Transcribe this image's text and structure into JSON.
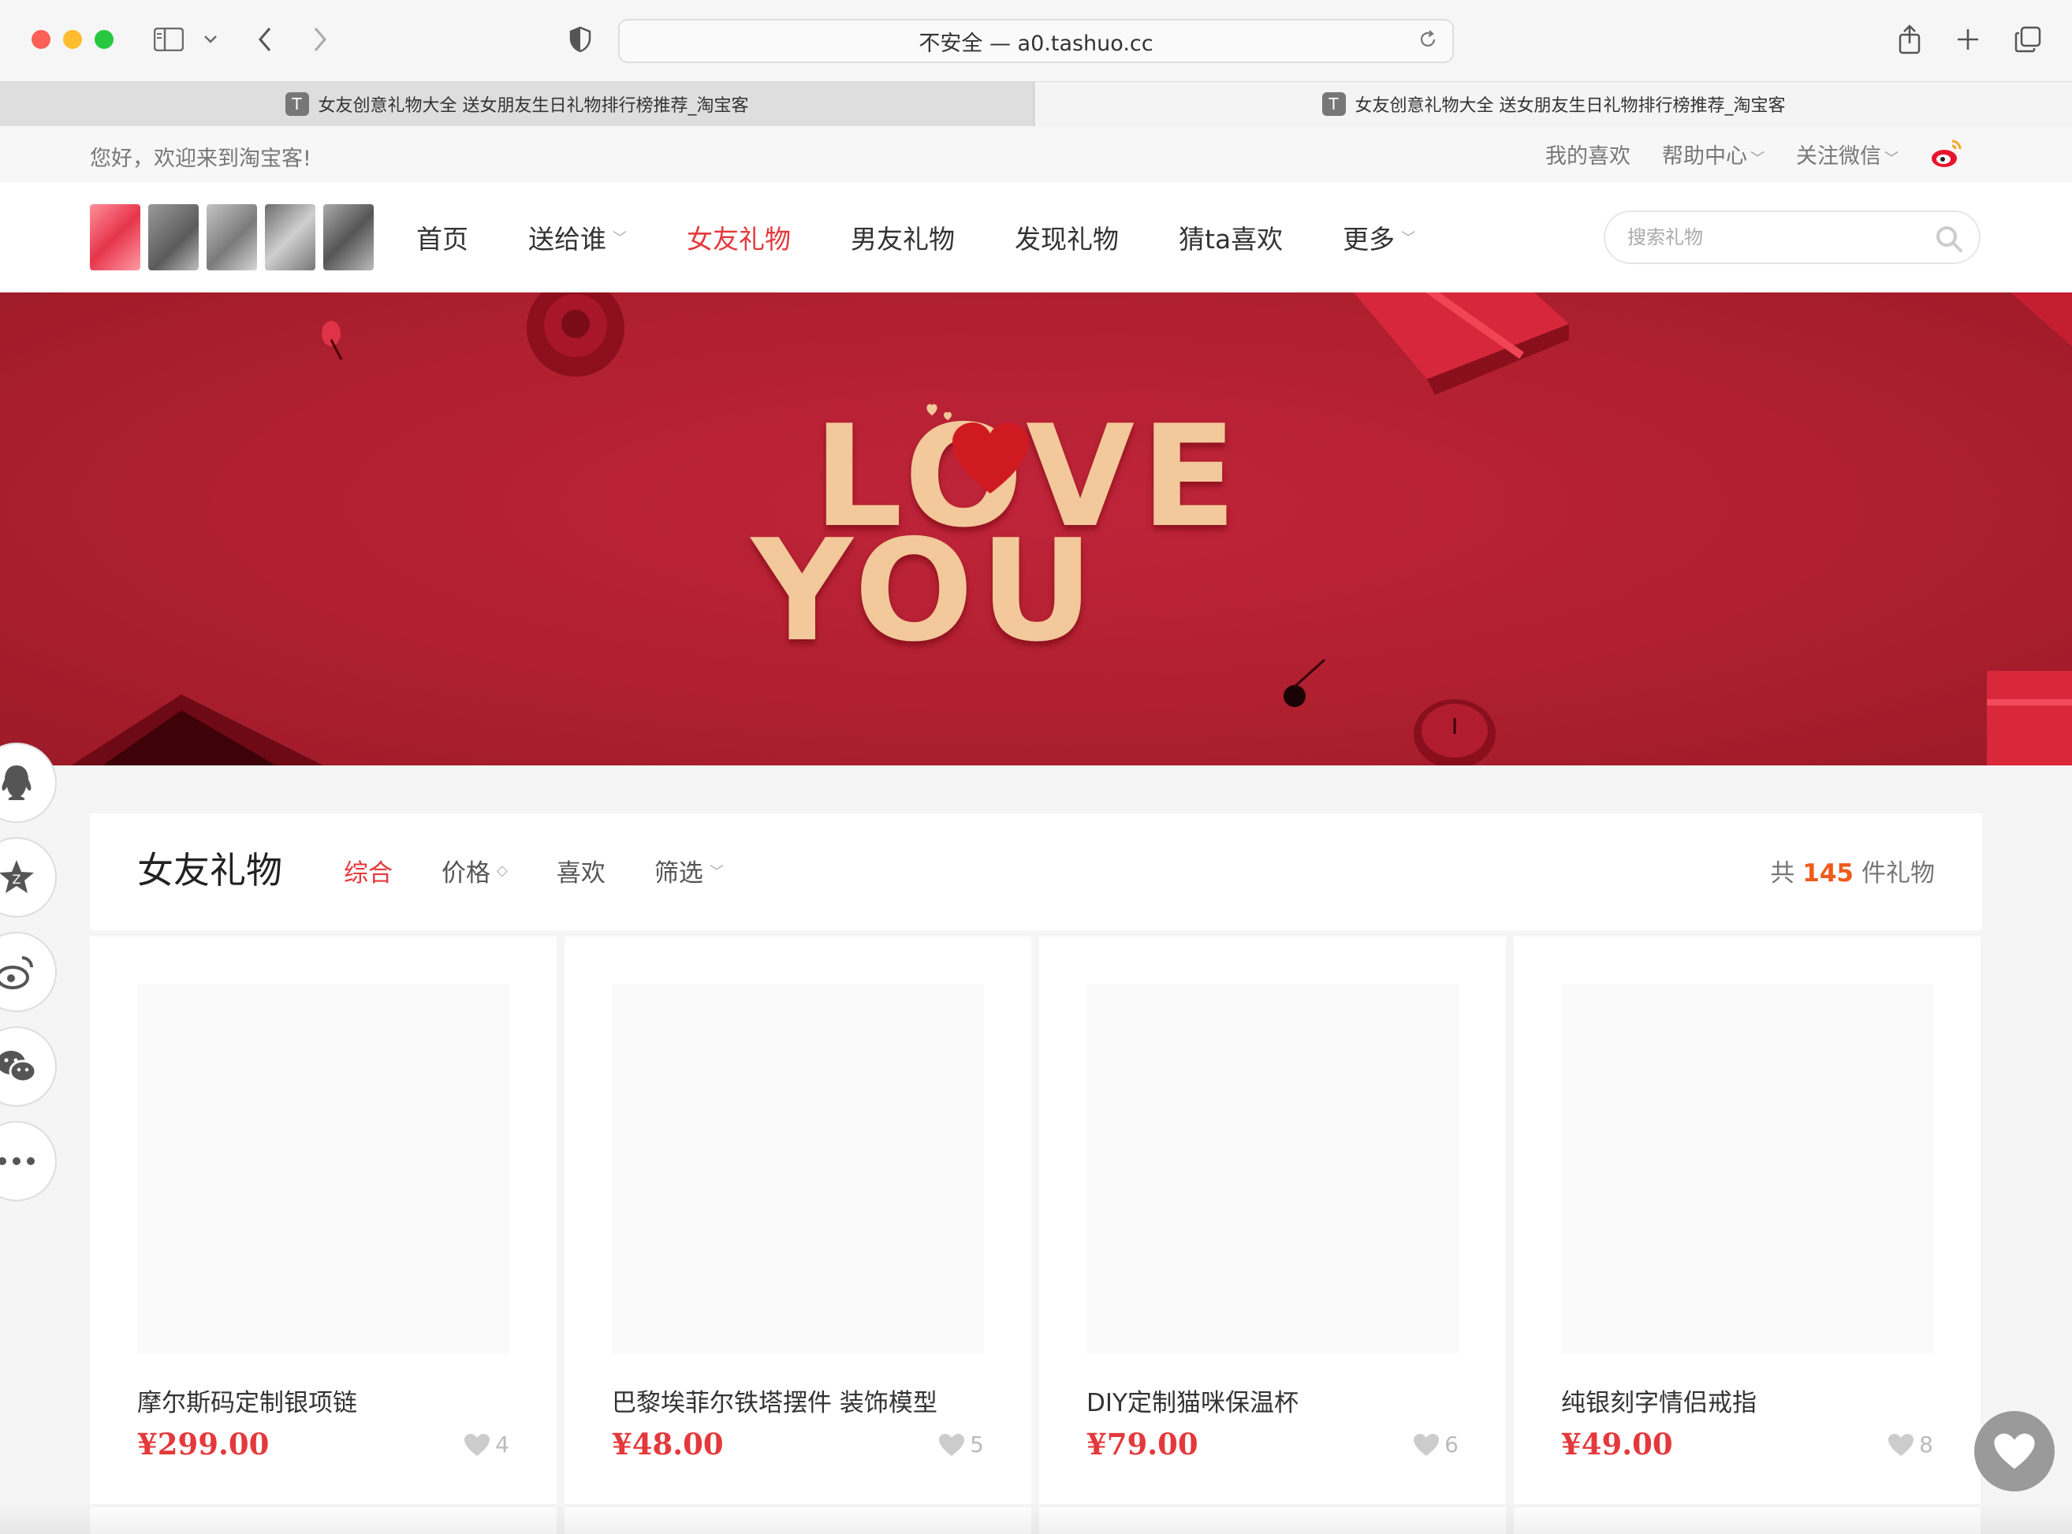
{
  "browser": {
    "address": "不安全 — a0.tashuo.cc",
    "tabs": [
      {
        "title": "女友创意礼物大全 送女朋友生日礼物排行榜推荐_淘宝客",
        "favicon": "T"
      },
      {
        "title": "女友创意礼物大全 送女朋友生日礼物排行榜推荐_淘宝客",
        "favicon": "T"
      }
    ]
  },
  "topbar": {
    "welcome": "您好，欢迎来到淘宝客!",
    "links": [
      {
        "label": "我的喜欢"
      },
      {
        "label": "帮助中心"
      },
      {
        "label": "关注微信"
      }
    ]
  },
  "nav": {
    "items": [
      {
        "label": "首页"
      },
      {
        "label": "送给谁"
      },
      {
        "label": "女友礼物"
      },
      {
        "label": "男友礼物"
      },
      {
        "label": "发现礼物"
      },
      {
        "label": "猜ta喜欢"
      },
      {
        "label": "更多"
      }
    ],
    "active": "女友礼物",
    "search_placeholder": "搜索礼物"
  },
  "banner": {
    "line1": "LOVE",
    "line2": "YOU"
  },
  "colors": {
    "accent": "#e4393c",
    "banner": "#b0202f",
    "gold": "#f3c89a",
    "count": "#f05a1a"
  },
  "listing": {
    "title": "女友礼物",
    "sort": [
      {
        "label": "综合"
      },
      {
        "label": "价格"
      },
      {
        "label": "喜欢"
      },
      {
        "label": "筛选"
      }
    ],
    "count_prefix": "共",
    "count": "145",
    "count_suffix": "件礼物"
  },
  "products": [
    {
      "name": "摩尔斯码定制银项链",
      "price": "¥299.00",
      "likes": "4"
    },
    {
      "name": "巴黎埃菲尔铁塔摆件 装饰模型",
      "price": "¥48.00",
      "likes": "5"
    },
    {
      "name": "DIY定制猫咪保温杯",
      "price": "¥79.00",
      "likes": "6"
    },
    {
      "name": "纯银刻字情侣戒指",
      "price": "¥49.00",
      "likes": "8"
    }
  ],
  "share_icons": [
    "qq-icon",
    "qzone-icon",
    "weibo-icon",
    "wechat-icon",
    "more-icon"
  ]
}
